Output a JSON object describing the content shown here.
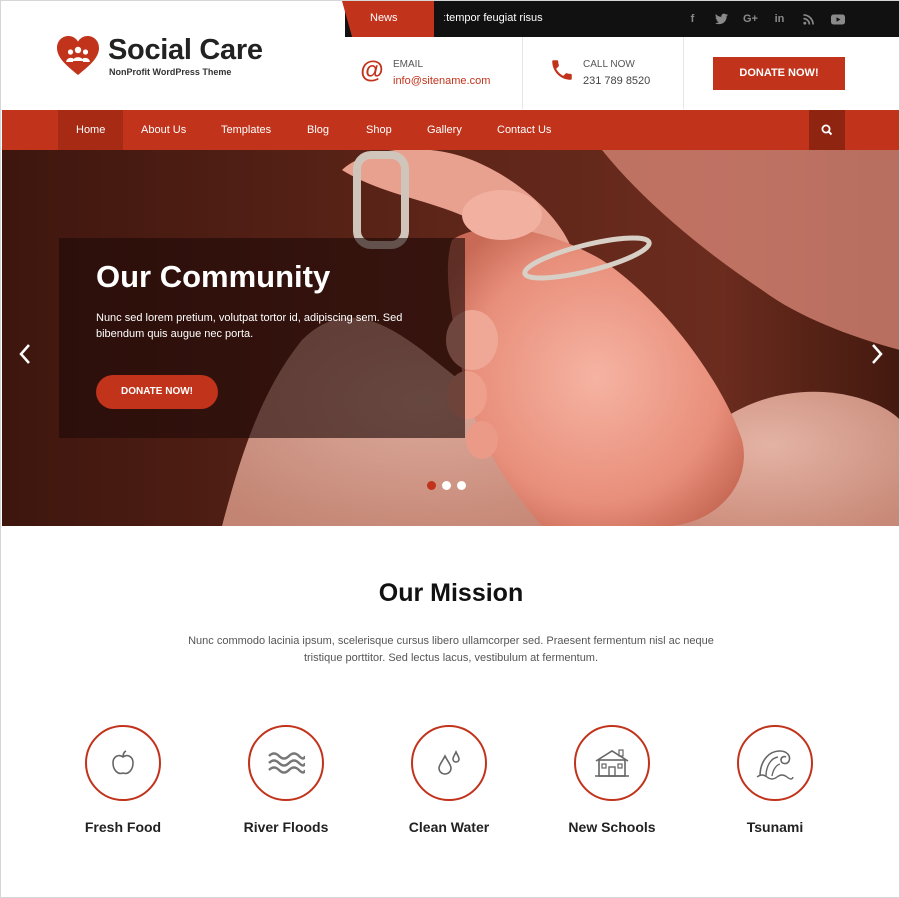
{
  "topbar": {
    "news_label": "News",
    "ticker_text": "tempor feugiat risus",
    "social_icons": [
      "facebook-icon",
      "twitter-icon",
      "google-plus-icon",
      "linkedin-icon",
      "rss-icon",
      "youtube-icon"
    ],
    "social_glyphs": [
      "f",
      "t",
      "G+",
      "in",
      "rss",
      "▶"
    ]
  },
  "header": {
    "logo_title": "Social Care",
    "logo_subtitle": "NonProfit WordPress Theme",
    "email_label": "EMAIL",
    "email_value": "info@sitename.com",
    "call_label": "CALL NOW",
    "call_value": "231 789 8520",
    "donate_label": "DONATE NOW!"
  },
  "nav": {
    "items": [
      "Home",
      "About Us",
      "Templates",
      "Blog",
      "Shop",
      "Gallery",
      "Contact Us"
    ],
    "active": "Home"
  },
  "hero": {
    "title": "Our Community",
    "text": "Nunc sed lorem pretium, volutpat tortor id, adipiscing sem. Sed bibendum quis augue nec porta.",
    "button_label": "DONATE NOW!",
    "slide_count": 3,
    "active_slide": 1
  },
  "mission": {
    "title": "Our Mission",
    "text": "Nunc commodo lacinia ipsum, scelerisque cursus libero ullamcorper sed. Praesent fermentum nisl ac neque tristique porttitor. Sed lectus lacus, vestibulum at fermentum.",
    "features": [
      {
        "label": "Fresh Food",
        "icon": "apple-icon"
      },
      {
        "label": "River Floods",
        "icon": "waves-icon"
      },
      {
        "label": "Clean Water",
        "icon": "water-drops-icon"
      },
      {
        "label": "New Schools",
        "icon": "school-icon"
      },
      {
        "label": "Tsunami",
        "icon": "tsunami-wave-icon"
      }
    ]
  },
  "colors": {
    "accent": "#c1331b",
    "accent_dark": "#a62a14",
    "topbar": "#111111"
  }
}
